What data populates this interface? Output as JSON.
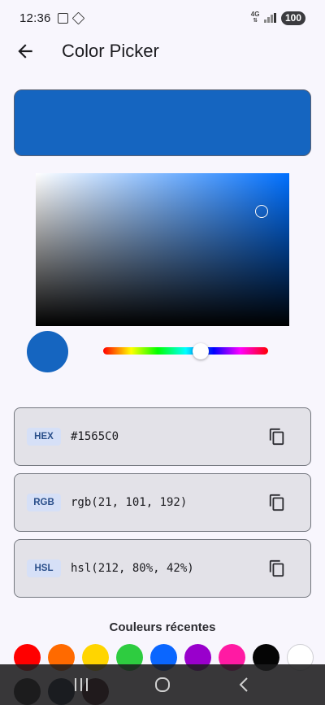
{
  "status_bar": {
    "time": "12:36",
    "network": "4G",
    "battery": "100"
  },
  "app_bar": {
    "title": "Color Picker",
    "back_icon": "arrow-left-icon"
  },
  "current_color": {
    "hex_color": "#1565C0",
    "hue_color": "#0070ff",
    "saturation": 0.89,
    "brightness": 0.75,
    "hue_fraction": 0.59
  },
  "codes": [
    {
      "tag": "HEX",
      "value": "#1565C0",
      "icon": "copy-icon"
    },
    {
      "tag": "RGB",
      "value": "rgb(21, 101, 192)",
      "icon": "copy-icon"
    },
    {
      "tag": "HSL",
      "value": "hsl(212, 80%, 42%)",
      "icon": "copy-icon"
    }
  ],
  "recent": {
    "title": "Couleurs récentes",
    "row1": [
      "#ff0000",
      "#ff6a00",
      "#ffd500",
      "#2ecc40",
      "#0a66ff",
      "#9900cc",
      "#ff1aa3",
      "#050505",
      "#ffffff"
    ],
    "row2": [
      "#1c1c1e",
      "#0e1a33",
      "#3a0d10"
    ]
  },
  "nav": {
    "recents_icon": "recents-icon",
    "home_icon": "home-icon",
    "back_icon": "back-icon"
  }
}
